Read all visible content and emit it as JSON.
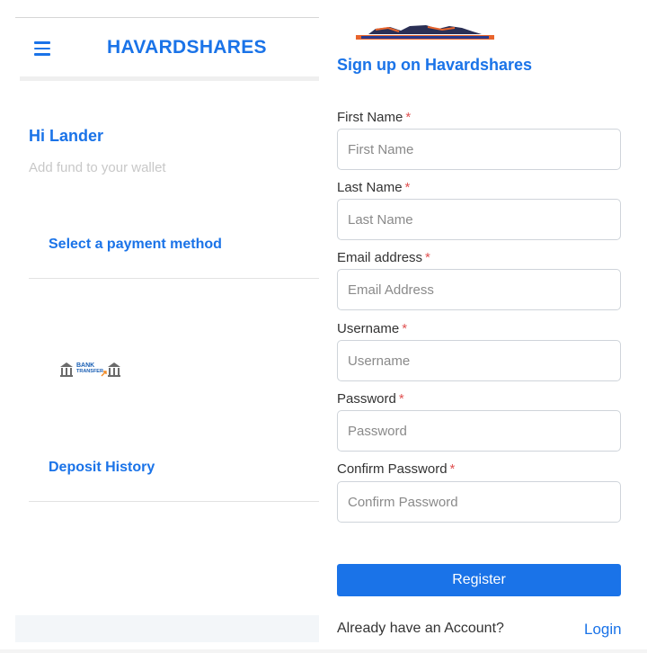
{
  "left": {
    "brand": "HAVARDSHARES",
    "greeting": "Hi Lander",
    "subtitle": "Add fund to your wallet",
    "payment_title": "Select a payment method",
    "bank_logo": {
      "line1": "BANK",
      "line2": "TRANSFER"
    },
    "deposit_title": "Deposit History"
  },
  "right": {
    "title": "Sign up on Havardshares",
    "fields": [
      {
        "label": "First Name",
        "required": "*",
        "placeholder": "First Name"
      },
      {
        "label": "Last Name",
        "required": "*",
        "placeholder": "Last Name"
      },
      {
        "label": "Email address",
        "required": "*",
        "placeholder": "Email Address"
      },
      {
        "label": "Username",
        "required": "*",
        "placeholder": "Username"
      },
      {
        "label": "Password",
        "required": "*",
        "placeholder": "Password"
      },
      {
        "label": "Confirm Password",
        "required": "*",
        "placeholder": "Confirm Password"
      }
    ],
    "register_label": "Register",
    "already_text": "Already have an Account?",
    "login_label": "Login"
  },
  "colors": {
    "accent": "#1a73e8",
    "required": "#e05252"
  },
  "icons": {
    "menu": "hamburger-icon",
    "bank": "bank-building-icon"
  }
}
